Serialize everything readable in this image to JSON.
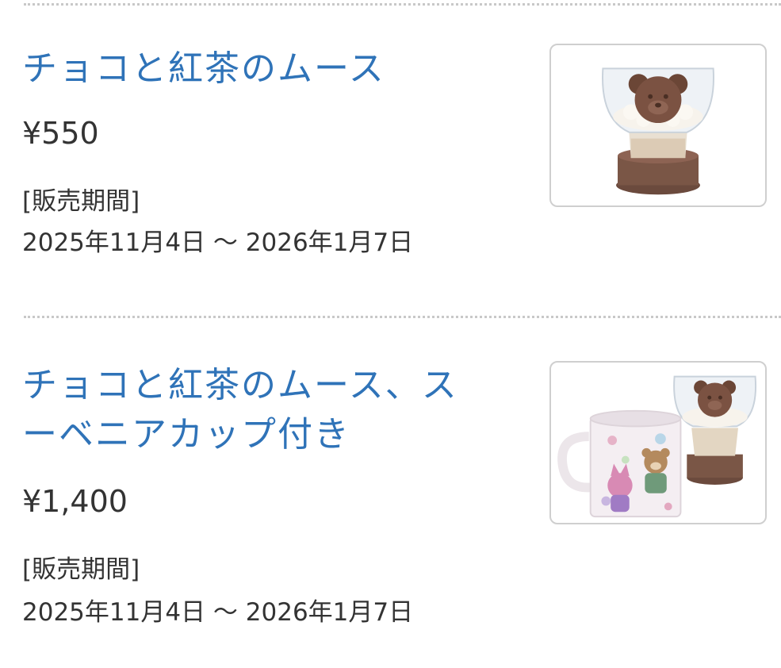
{
  "items": [
    {
      "title": "チョコと紅茶のムース",
      "price": "¥550",
      "period_label": "[販売期間]",
      "period_dates": "2025年11月4日 〜 2026年1月7日",
      "image_icon": "mousse-cup-image"
    },
    {
      "title": "チョコと紅茶のムース、スーベニアカップ付き",
      "price": "¥1,400",
      "period_label": "[販売期間]",
      "period_dates": "2025年11月4日 〜 2026年1月7日",
      "image_icon": "mousse-with-souvenir-mug-image"
    }
  ],
  "colors": {
    "title": "#2f73b8",
    "text": "#333333",
    "divider": "#c8c8c8",
    "thumb_border": "#cfcfcf"
  }
}
